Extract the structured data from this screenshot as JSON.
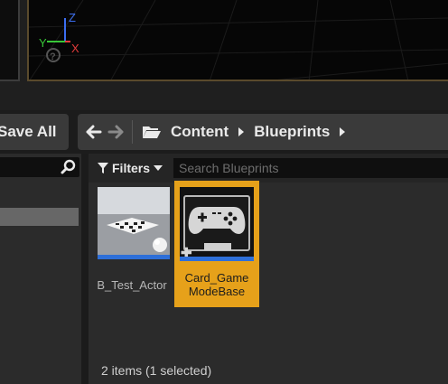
{
  "toolbar": {
    "save_all_label": "Save All",
    "breadcrumbs": [
      "Content",
      "Blueprints"
    ]
  },
  "viewport": {
    "axis_x": "X",
    "axis_y": "Y",
    "axis_z": "Z"
  },
  "content_browser": {
    "filters_label": "Filters",
    "search_placeholder": "Search Blueprints",
    "assets": [
      {
        "name": "B_Test_Actor",
        "selected": false,
        "icon": "actor-thumbnail-icon"
      },
      {
        "name": "Card_Game\nModeBase",
        "selected": true,
        "icon": "gamepad-icon"
      }
    ],
    "status": "2 items (1 selected)"
  },
  "colors": {
    "selection": "#e6a11a",
    "asset_bar": "#2e6fd8",
    "axis_x": "#e23b3b",
    "axis_y": "#38c638",
    "axis_z": "#3b6ef0"
  }
}
